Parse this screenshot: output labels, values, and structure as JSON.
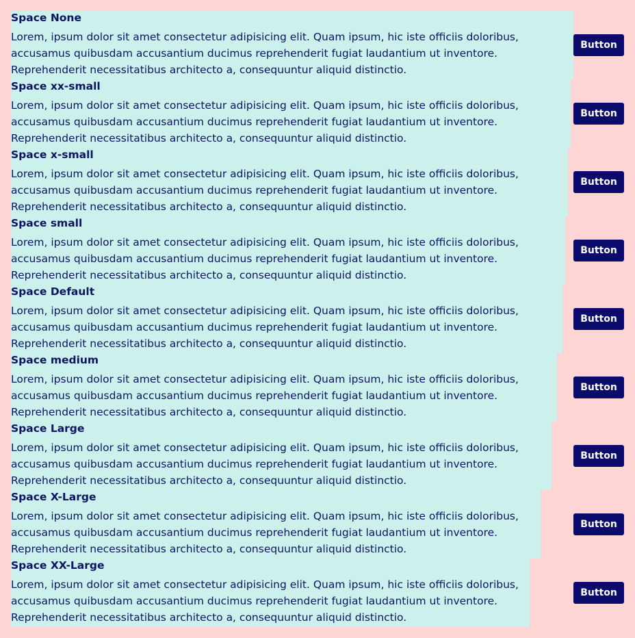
{
  "colors": {
    "page_background": "#ffd6d6",
    "content_background": "#ccf0ec",
    "text": "#0b1560",
    "button_background": "#0b0b6b",
    "button_text": "#ffffff"
  },
  "rows": [
    {
      "title": "Space None",
      "body": "Lorem, ipsum dolor sit amet consectetur adipisicing elit. Quam ipsum, hic iste officiis doloribus, accusamus quibusdam accusantium ducimus reprehenderit fugiat laudantium ut inventore. Reprehenderit necessitatibus architecto a, consequuntur aliquid distinctio.",
      "button": "Button"
    },
    {
      "title": "Space xx-small",
      "body": "Lorem, ipsum dolor sit amet consectetur adipisicing elit. Quam ipsum, hic iste officiis doloribus, accusamus quibusdam accusantium ducimus reprehenderit fugiat laudantium ut inventore. Reprehenderit necessitatibus architecto a, consequuntur aliquid distinctio.",
      "button": "Button"
    },
    {
      "title": "Space x-small",
      "body": "Lorem, ipsum dolor sit amet consectetur adipisicing elit. Quam ipsum, hic iste officiis doloribus, accusamus quibusdam accusantium ducimus reprehenderit fugiat laudantium ut inventore. Reprehenderit necessitatibus architecto a, consequuntur aliquid distinctio.",
      "button": "Button"
    },
    {
      "title": "Space small",
      "body": "Lorem, ipsum dolor sit amet consectetur adipisicing elit. Quam ipsum, hic iste officiis doloribus, accusamus quibusdam accusantium ducimus reprehenderit fugiat laudantium ut inventore. Reprehenderit necessitatibus architecto a, consequuntur aliquid distinctio.",
      "button": "Button"
    },
    {
      "title": "Space Default",
      "body": "Lorem, ipsum dolor sit amet consectetur adipisicing elit. Quam ipsum, hic iste officiis doloribus, accusamus quibusdam accusantium ducimus reprehenderit fugiat laudantium ut inventore. Reprehenderit necessitatibus architecto a, consequuntur aliquid distinctio.",
      "button": "Button"
    },
    {
      "title": "Space medium",
      "body": "Lorem, ipsum dolor sit amet consectetur adipisicing elit. Quam ipsum, hic iste officiis doloribus, accusamus quibusdam accusantium ducimus reprehenderit fugiat laudantium ut inventore. Reprehenderit necessitatibus architecto a, consequuntur aliquid distinctio.",
      "button": "Button"
    },
    {
      "title": "Space Large",
      "body": "Lorem, ipsum dolor sit amet consectetur adipisicing elit. Quam ipsum, hic iste officiis doloribus, accusamus quibusdam accusantium ducimus reprehenderit fugiat laudantium ut inventore. Reprehenderit necessitatibus architecto a, consequuntur aliquid distinctio.",
      "button": "Button"
    },
    {
      "title": "Space X-Large",
      "body": "Lorem, ipsum dolor sit amet consectetur adipisicing elit. Quam ipsum, hic iste officiis doloribus, accusamus quibusdam accusantium ducimus reprehenderit fugiat laudantium ut inventore. Reprehenderit necessitatibus architecto a, consequuntur aliquid distinctio.",
      "button": "Button"
    },
    {
      "title": "Space XX-Large",
      "body": "Lorem, ipsum dolor sit amet consectetur adipisicing elit. Quam ipsum, hic iste officiis doloribus, accusamus quibusdam accusantium ducimus reprehenderit fugiat laudantium ut inventore. Reprehenderit necessitatibus architecto a, consequuntur aliquid distinctio.",
      "button": "Button"
    }
  ]
}
